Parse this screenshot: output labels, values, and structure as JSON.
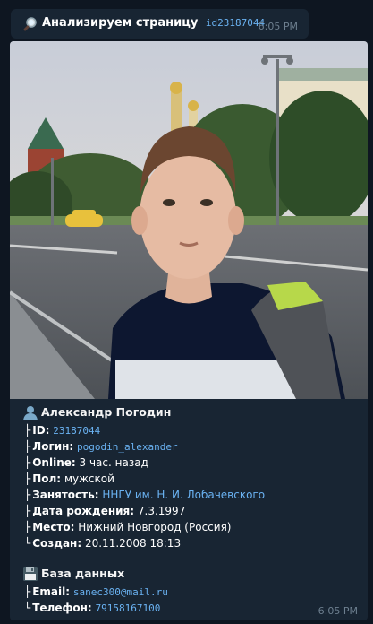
{
  "top_message": {
    "title": "Анализируем страницу",
    "id_link": "id23187044",
    "time": "6:05 PM"
  },
  "profile": {
    "name": "Александр Погодин",
    "fields": [
      {
        "label": "ID:",
        "value": "23187044",
        "style": "mono"
      },
      {
        "label": "Логин:",
        "value": "pogodin_alexander",
        "style": "mono"
      },
      {
        "label": "Online:",
        "value": "3 час. назад",
        "style": "plain"
      },
      {
        "label": "Пол:",
        "value": "мужской",
        "style": "plain"
      },
      {
        "label": "Занятость:",
        "value": "ННГУ им. Н. И. Лобачевского",
        "style": "link"
      },
      {
        "label": "Дата рождения:",
        "value": "7.3.1997",
        "style": "plain"
      },
      {
        "label": "Место:",
        "value": "Нижний Новгород (Россия)",
        "style": "plain"
      },
      {
        "label": "Создан:",
        "value": "20.11.2008 18:13",
        "style": "plain"
      }
    ]
  },
  "database": {
    "title": "База данных",
    "fields": [
      {
        "label": "Email:",
        "value": "sanec300@mail.ru",
        "style": "mono"
      },
      {
        "label": "Телефон:",
        "value": "79158167100",
        "style": "mono"
      }
    ]
  },
  "main_time": "6:05 PM",
  "icons": {
    "top": "magnifier-icon",
    "profile": "user-silhouette-icon",
    "database": "floppy-disk-icon"
  },
  "colors": {
    "background": "#0e1621",
    "bubble": "#182533",
    "link": "#6ab2f2",
    "time": "#6d7f8f"
  }
}
